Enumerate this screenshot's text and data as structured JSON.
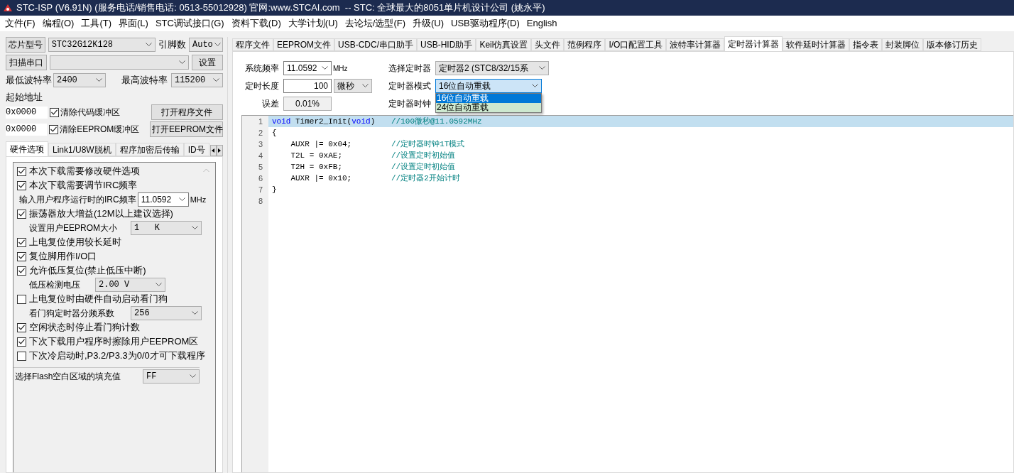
{
  "window": {
    "title": "STC-ISP (V6.91N) (服务电话/销售电话: 0513-55012928) 官网:www.STCAI.com  -- STC: 全球最大的8051单片机设计公司 (姚永平)"
  },
  "menu": [
    "文件(F)",
    "编程(O)",
    "工具(T)",
    "界面(L)",
    "STC调试接口(G)",
    "资料下载(D)",
    "大学计划(U)",
    "去论坛/选型(F)",
    "升级(U)",
    "USB驱动程序(D)",
    "English"
  ],
  "left": {
    "chip_button": "芯片型号",
    "chip_value": "STC32G12K128",
    "pins_label": "引脚数",
    "pins_value": "Auto",
    "scan_button": "扫描串口",
    "settings_button": "设置",
    "min_baud_label": "最低波特率",
    "min_baud_value": "2400",
    "max_baud_label": "最高波特率",
    "max_baud_value": "115200",
    "start_address_label": "起始地址",
    "address_rows": [
      {
        "address": "0x0000",
        "label": "清除代码缓冲区",
        "checked": true,
        "button": "打开程序文件"
      },
      {
        "address": "0x0000",
        "label": "清除EEPROM缓冲区",
        "checked": true,
        "button": "打开EEPROM文件"
      }
    ],
    "tabs": [
      {
        "label": "硬件选项",
        "selected": true
      },
      {
        "label": "Link1/U8W脱机",
        "selected": false
      },
      {
        "label": "程序加密后传输",
        "selected": false
      },
      {
        "label": "ID号",
        "selected": false
      }
    ],
    "options": [
      {
        "kind": "checkbox",
        "label": "本次下载需要修改硬件选项",
        "checked": true
      },
      {
        "kind": "checkbox",
        "label": "本次下载需要调节IRC频率",
        "checked": true
      },
      {
        "kind": "freq",
        "label": "输入用户程序运行时的IRC频率",
        "value": "11.0592",
        "unit": "MHz"
      },
      {
        "kind": "checkbox",
        "label": "振荡器放大增益(12M以上建议选择)",
        "checked": true
      },
      {
        "kind": "select",
        "label": "设置用户EEPROM大小",
        "value": "1   K"
      },
      {
        "kind": "checkbox",
        "label": "上电复位使用较长延时",
        "checked": true
      },
      {
        "kind": "checkbox",
        "label": "复位脚用作I/O口",
        "checked": true
      },
      {
        "kind": "checkbox",
        "label": "允许低压复位(禁止低压中断)",
        "checked": true
      },
      {
        "kind": "select-short",
        "label": "低压检测电压",
        "value": "2.00 V"
      },
      {
        "kind": "checkbox",
        "label": "上电复位时由硬件自动启动看门狗",
        "checked": false
      },
      {
        "kind": "select",
        "label": "看门狗定时器分频系数",
        "value": "256"
      },
      {
        "kind": "checkbox",
        "label": "空闲状态时停止看门狗计数",
        "checked": true
      },
      {
        "kind": "checkbox",
        "label": "下次下载用户程序时擦除用户EEPROM区",
        "checked": true
      },
      {
        "kind": "checkbox",
        "label": "下次冷启动时,P3.2/P3.3为0/0才可下载程序",
        "checked": false
      }
    ],
    "fill_label": "选择Flash空白区域的填充值",
    "fill_value": "FF"
  },
  "right": {
    "tabs": [
      {
        "label": "程序文件",
        "selected": false
      },
      {
        "label": "EEPROM文件",
        "selected": false
      },
      {
        "label": "USB-CDC/串口助手",
        "selected": false
      },
      {
        "label": "USB-HID助手",
        "selected": false
      },
      {
        "label": "Keil仿真设置",
        "selected": false
      },
      {
        "label": "头文件",
        "selected": false
      },
      {
        "label": "范例程序",
        "selected": false
      },
      {
        "label": "I/O口配置工具",
        "selected": false
      },
      {
        "label": "波特率计算器",
        "selected": false
      },
      {
        "label": "定时器计算器",
        "selected": true
      },
      {
        "label": "软件延时计算器",
        "selected": false
      },
      {
        "label": "指令表",
        "selected": false
      },
      {
        "label": "封装脚位",
        "selected": false
      },
      {
        "label": "版本修订历史",
        "selected": false
      }
    ],
    "sys_freq_label": "系统频率",
    "sys_freq_value": "11.0592",
    "sys_freq_unit": "MHz",
    "timer_select_label": "选择定时器",
    "timer_select_value": "定时器2 (STC8/32/15系",
    "length_label": "定时长度",
    "length_value": "100",
    "length_unit": "微秒",
    "mode_label": "定时器模式",
    "mode_value": "16位自动重载",
    "mode_options": [
      {
        "label": "16位自动重载",
        "selected": true,
        "hovered": false
      },
      {
        "label": "24位自动重载",
        "selected": false,
        "hovered": true
      }
    ],
    "error_label": "误差",
    "error_value": "0.01%",
    "clock_label": "定时器时钟",
    "code": [
      {
        "number": "1",
        "selected": true,
        "segments": [
          {
            "kind": "keyword",
            "text": "void"
          },
          {
            "kind": "plain",
            "text": " Timer2_Init("
          },
          {
            "kind": "keyword",
            "text": "void"
          },
          {
            "kind": "plain",
            "text": ")"
          }
        ],
        "comment": "//100微秒@11.0592MHz"
      },
      {
        "number": "2",
        "selected": false,
        "segments": [
          {
            "kind": "plain",
            "text": "{"
          }
        ]
      },
      {
        "number": "3",
        "selected": false,
        "segments": [
          {
            "kind": "plain",
            "text": "    AUXR |= 0x04;"
          }
        ],
        "comment": "//定时器时钟1T模式"
      },
      {
        "number": "4",
        "selected": false,
        "segments": [
          {
            "kind": "plain",
            "text": "    T2L = 0xAE;"
          }
        ],
        "comment": "//设置定时初始值"
      },
      {
        "number": "5",
        "selected": false,
        "segments": [
          {
            "kind": "plain",
            "text": "    T2H = 0xFB;"
          }
        ],
        "comment": "//设置定时初始值"
      },
      {
        "number": "6",
        "selected": false,
        "segments": [
          {
            "kind": "plain",
            "text": "    AUXR |= 0x10;"
          }
        ],
        "comment": "//定时器2开始计时"
      },
      {
        "number": "7",
        "selected": false,
        "segments": [
          {
            "kind": "plain",
            "text": "}"
          }
        ]
      },
      {
        "number": "8",
        "selected": false
      }
    ]
  }
}
